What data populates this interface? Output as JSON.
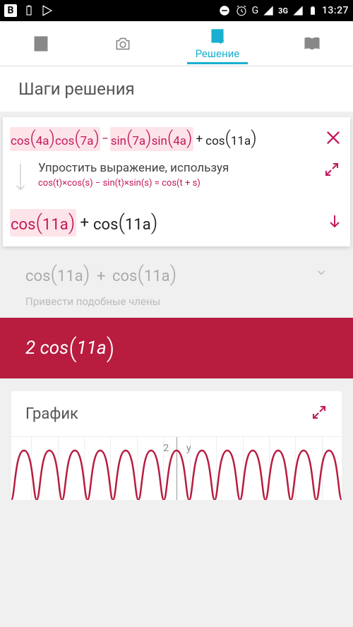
{
  "status": {
    "time": "13:27",
    "network": "3G",
    "g_icon": "G"
  },
  "tabs": {
    "active_label": "Решение"
  },
  "steps_header": "Шаги решения",
  "step1": {
    "expr_parts": {
      "cos": "cos",
      "sin": "sin",
      "p1": "4a",
      "p2": "7a",
      "p3": "7a",
      "p4": "4a",
      "p5": "11a",
      "minus": "−",
      "plus": "+"
    },
    "rule_title": "Упростить выражение, используя",
    "rule_formula": "cos(t)×cos(s) − sin(t)×sin(s) = cos(t + s)",
    "result_a": "cos",
    "result_a_arg": "11a",
    "result_plus": "+",
    "result_b": "cos",
    "result_b_arg": "11a"
  },
  "faded": {
    "line": "cos(11a) + cos(11a)",
    "a": "cos",
    "arg": "11a",
    "plus": "+",
    "hint": "Привести подобные члены"
  },
  "final": {
    "coef": "2",
    "fn": "cos",
    "arg": "11a"
  },
  "graph": {
    "title": "График",
    "y_label": "y",
    "tick": "2"
  },
  "chart_data": {
    "type": "line",
    "function": "2*cos(11*a)",
    "title": "График",
    "xlabel": "",
    "ylabel": "y",
    "ylim": [
      -2,
      2
    ],
    "amplitude": 2,
    "angular_frequency": 11
  }
}
